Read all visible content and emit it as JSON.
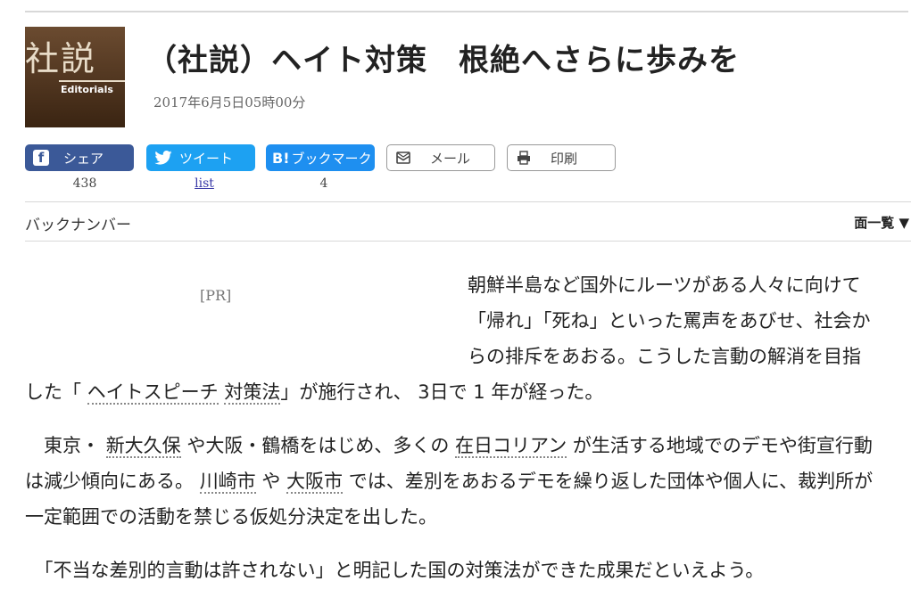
{
  "logo": {
    "kanji": "社説",
    "en": "Editorials"
  },
  "headline": {
    "title": "（社説）ヘイト対策　根絶へさらに歩みを",
    "date": "2017年6月5日05時00分"
  },
  "share": {
    "facebook": {
      "label": "シェア",
      "count": "438"
    },
    "twitter": {
      "label": "ツイート",
      "count": "list"
    },
    "hatena": {
      "icon_text": "B!",
      "label": "ブックマーク",
      "count": "4"
    },
    "mail": {
      "label": "メール"
    },
    "print": {
      "label": "印刷"
    }
  },
  "nav": {
    "back_number": "バックナンバー",
    "menu_all": "面一覧 ▼"
  },
  "ad": {
    "label": "[PR]"
  },
  "article": {
    "p1": {
      "a": "朝鮮半島など国外にルーツがある人々に向けて「帰れ」「死ね」といった罵声をあびせ、社会からの排斥をあおる。こうした言動の解消を目指した「 ",
      "k1": "ヘイトスピーチ",
      "b": " ",
      "k2": "対策法",
      "c": "」が施行され、 3日で 1 年が経った。"
    },
    "p2": {
      "a": "東京・ ",
      "k1": "新大久保",
      "b": " や大阪・鶴橋をはじめ、多くの ",
      "k2": "在日コリアン",
      "c": " が生活する地域でのデモや街宣行動は減少傾向にある。 ",
      "k3": "川崎市",
      "d": " や ",
      "k4": "大阪市",
      "e": " では、差別をあおるデモを繰り返した団体や個人に、裁判所が一定範囲での活動を禁じる仮処分決定を出した。"
    },
    "p3": "「不当な差別的言動は許されない」と明記した国の対策法ができた成果だといえよう。"
  }
}
